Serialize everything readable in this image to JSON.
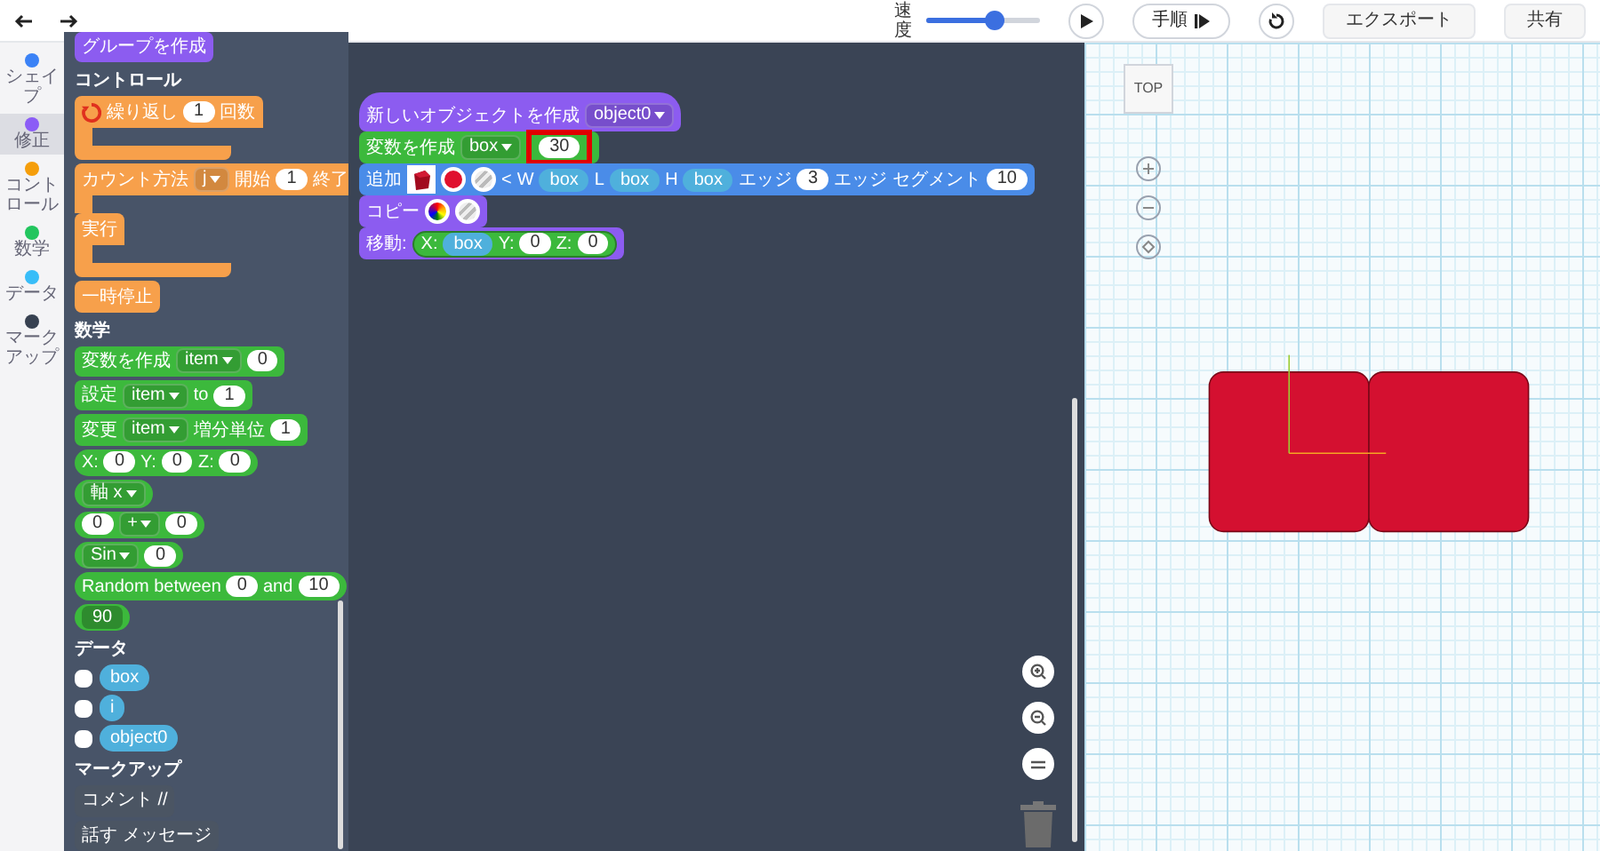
{
  "toolbar": {
    "speed_label": "速度",
    "speed": {
      "level": 0.6
    },
    "buttons": [
      {
        "kind": "play"
      },
      {
        "kind": "step",
        "label": "手順"
      },
      {
        "kind": "reset"
      },
      {
        "kind": "text",
        "label": "エクスポート"
      },
      {
        "kind": "text",
        "label": "共有"
      }
    ]
  },
  "categories": [
    {
      "label": "シェイプ",
      "color": "#3b82f6",
      "selected": false
    },
    {
      "label": "修正",
      "color": "#8b5cf6",
      "selected": true
    },
    {
      "label": "コントロール",
      "color": "#f59e0b",
      "selected": false
    },
    {
      "label": "数学",
      "color": "#22c55e",
      "selected": false
    },
    {
      "label": "データ",
      "color": "#38bdf8",
      "selected": false
    },
    {
      "label": "マークアップ",
      "color": "#374151",
      "selected": false
    }
  ],
  "toolbox": [
    {
      "blocks": [
        {
          "kind": "stack",
          "color": "#8c5cf0",
          "rows": [
            [
              {
                "kind": "text",
                "text": "グループを作成"
              }
            ]
          ]
        }
      ]
    },
    {
      "header": "コントロール",
      "blocks": [
        {
          "kind": "c",
          "color": "#f7a04b",
          "rows": [
            [
              {
                "kind": "loop-icon"
              },
              {
                "kind": "text",
                "text": "繰り返し"
              },
              {
                "kind": "number",
                "text": "1"
              },
              {
                "kind": "text",
                "text": "回数"
              }
            ]
          ]
        },
        {
          "kind": "c",
          "color": "#f7a04b",
          "rows": [
            [
              {
                "kind": "text",
                "text": "カウント方法"
              },
              {
                "kind": "dropdown",
                "text": "j"
              },
              {
                "kind": "text",
                "text": "開始"
              },
              {
                "kind": "number",
                "text": "1"
              },
              {
                "kind": "text",
                "text": "終了"
              }
            ],
            [
              {
                "kind": "text",
                "text": "実行"
              }
            ]
          ]
        },
        {
          "kind": "stack",
          "color": "#f7a04b",
          "rows": [
            [
              {
                "kind": "text",
                "text": "一時停止"
              }
            ]
          ]
        }
      ]
    },
    {
      "header": "数学",
      "blocks": [
        {
          "kind": "stack",
          "color": "#3cb93c",
          "rows": [
            [
              {
                "kind": "text",
                "text": "変数を作成"
              },
              {
                "kind": "dropdown",
                "text": "item"
              },
              {
                "kind": "number",
                "text": "0"
              }
            ]
          ]
        },
        {
          "kind": "stack",
          "color": "#3cb93c",
          "rows": [
            [
              {
                "kind": "text",
                "text": "設定"
              },
              {
                "kind": "dropdown",
                "text": "item"
              },
              {
                "kind": "text",
                "text": "to"
              },
              {
                "kind": "number",
                "text": "1"
              }
            ]
          ]
        },
        {
          "kind": "stack",
          "color": "#3cb93c",
          "rows": [
            [
              {
                "kind": "text",
                "text": "変更"
              },
              {
                "kind": "dropdown",
                "text": "item"
              },
              {
                "kind": "text",
                "text": "増分単位"
              },
              {
                "kind": "number",
                "text": "1"
              }
            ]
          ]
        },
        {
          "kind": "reporter",
          "color": "#3cb93c",
          "rows": [
            [
              {
                "kind": "text",
                "text": "X:"
              },
              {
                "kind": "number",
                "text": "0"
              },
              {
                "kind": "text",
                "text": "Y:"
              },
              {
                "kind": "number",
                "text": "0"
              },
              {
                "kind": "text",
                "text": "Z:"
              },
              {
                "kind": "number",
                "text": "0"
              }
            ]
          ]
        },
        {
          "kind": "reporter",
          "color": "#3cb93c",
          "rows": [
            [
              {
                "kind": "dropdown",
                "text": "軸 x"
              }
            ]
          ]
        },
        {
          "kind": "reporter",
          "color": "#3cb93c",
          "rows": [
            [
              {
                "kind": "number",
                "text": "0"
              },
              {
                "kind": "dropdown",
                "text": "+"
              },
              {
                "kind": "number",
                "text": "0"
              }
            ]
          ]
        },
        {
          "kind": "reporter",
          "color": "#3cb93c",
          "rows": [
            [
              {
                "kind": "dropdown",
                "text": "Sin"
              },
              {
                "kind": "number",
                "text": "0"
              }
            ]
          ]
        },
        {
          "kind": "reporter",
          "color": "#3cb93c",
          "rows": [
            [
              {
                "kind": "text",
                "text": "Random between"
              },
              {
                "kind": "number",
                "text": "0"
              },
              {
                "kind": "text",
                "text": "and"
              },
              {
                "kind": "number",
                "text": "10"
              }
            ]
          ]
        },
        {
          "kind": "reporter",
          "color": "#3cb93c",
          "rows": [
            [
              {
                "kind": "field",
                "text": "90"
              }
            ]
          ]
        }
      ]
    },
    {
      "header": "データ",
      "variables": [
        {
          "name": "box",
          "checked": false
        },
        {
          "name": "i",
          "checked": false
        },
        {
          "name": "object0",
          "checked": false
        }
      ]
    },
    {
      "header": "マークアップ",
      "blocks": [
        {
          "kind": "stack",
          "color": "#4b5563",
          "rows": [
            [
              {
                "kind": "text",
                "text": "コメント //"
              }
            ]
          ]
        },
        {
          "kind": "stack",
          "color": "#4b5563",
          "rows": [
            [
              {
                "kind": "text",
                "text": "話す"
              },
              {
                "kind": "text",
                "text": "メッセージ"
              }
            ]
          ]
        }
      ]
    }
  ],
  "workspace": {
    "blocks": [
      {
        "kind": "hat",
        "color": "#8c5cf0",
        "rows": [
          [
            {
              "kind": "text",
              "text": "新しいオブジェクトを作成"
            },
            {
              "kind": "dropdown",
              "text": "object0"
            }
          ]
        ]
      },
      {
        "kind": "stack",
        "color": "#3cb93c",
        "rows": [
          [
            {
              "kind": "text",
              "text": "変数を作成"
            },
            {
              "kind": "dropdown",
              "text": "box"
            },
            {
              "kind": "number",
              "text": "30",
              "highlight": true
            }
          ]
        ]
      },
      {
        "kind": "stack",
        "color": "#4a8ce8",
        "rows": [
          [
            {
              "kind": "text",
              "text": "追加"
            },
            {
              "kind": "cube"
            },
            {
              "kind": "color",
              "color": "#e0102e"
            },
            {
              "kind": "striped"
            },
            {
              "kind": "text",
              "text": "<"
            },
            {
              "kind": "text",
              "text": "W"
            },
            {
              "kind": "var",
              "text": "box"
            },
            {
              "kind": "text",
              "text": "L"
            },
            {
              "kind": "var",
              "text": "box"
            },
            {
              "kind": "text",
              "text": "H"
            },
            {
              "kind": "var",
              "text": "box"
            },
            {
              "kind": "text",
              "text": "エッジ"
            },
            {
              "kind": "number",
              "text": "3"
            },
            {
              "kind": "text",
              "text": "エッジ セグメント"
            },
            {
              "kind": "number",
              "text": "10"
            }
          ]
        ]
      },
      {
        "kind": "stack",
        "color": "#8c5cf0",
        "rows": [
          [
            {
              "kind": "text",
              "text": "コピー"
            },
            {
              "kind": "rainbow"
            },
            {
              "kind": "striped"
            }
          ]
        ]
      },
      {
        "kind": "stack",
        "color": "#8c5cf0",
        "rows": [
          [
            {
              "kind": "text",
              "text": "移動:"
            },
            {
              "kind": "reporter",
              "color": "#3cb93c",
              "parts": [
                {
                  "kind": "text",
                  "text": "X:"
                },
                {
                  "kind": "var",
                  "text": "box"
                },
                {
                  "kind": "text",
                  "text": "Y:"
                },
                {
                  "kind": "number",
                  "text": "0"
                },
                {
                  "kind": "text",
                  "text": "Z:"
                },
                {
                  "kind": "number",
                  "text": "0"
                }
              ]
            }
          ]
        ]
      }
    ]
  },
  "viewer": {
    "view_label": "TOP"
  }
}
